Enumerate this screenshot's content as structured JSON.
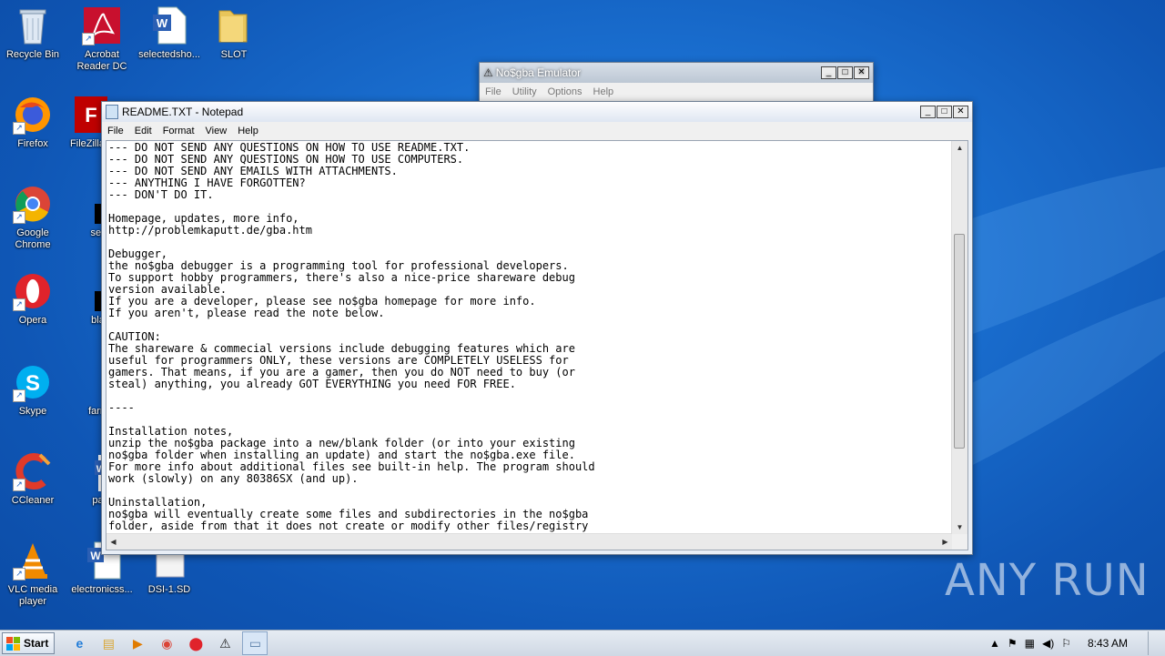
{
  "desktop_icons": [
    {
      "label": "Recycle Bin",
      "icon": "recycle-bin-icon"
    },
    {
      "label": "Acrobat\nReader DC",
      "icon": "acrobat-icon"
    },
    {
      "label": "selectedsho...",
      "icon": "word-doc-icon"
    },
    {
      "label": "SLOT",
      "icon": "folder-icon"
    },
    {
      "label": "Firefox",
      "icon": "firefox-icon"
    },
    {
      "label": "FileZilla",
      "icon": "filezilla-icon"
    },
    {
      "label": "Google\nChrome",
      "icon": "chrome-icon"
    },
    {
      "label": "second",
      "icon": "black-file-icon"
    },
    {
      "label": "Opera",
      "icon": "opera-icon"
    },
    {
      "label": "blackm",
      "icon": "black-file-icon"
    },
    {
      "label": "Skype",
      "icon": "skype-icon"
    },
    {
      "label": "farmore",
      "icon": "generic-file-icon"
    },
    {
      "label": "CCleaner",
      "icon": "ccleaner-icon"
    },
    {
      "label": "papers",
      "icon": "word-doc-icon"
    },
    {
      "label": "VLC media\nplayer",
      "icon": "vlc-icon"
    },
    {
      "label": "electronicss...",
      "icon": "word-doc-icon"
    },
    {
      "label": "DSI-1.SD",
      "icon": "blank-file-icon"
    }
  ],
  "nogba": {
    "title": "No$gba Emulator",
    "menu": [
      "File",
      "Utility",
      "Options",
      "Help"
    ]
  },
  "notepad": {
    "title": "README.TXT - Notepad",
    "menu": [
      "File",
      "Edit",
      "Format",
      "View",
      "Help"
    ],
    "content": "--- DO NOT SEND ANY QUESTIONS ON HOW TO USE README.TXT.\n--- DO NOT SEND ANY QUESTIONS ON HOW TO USE COMPUTERS.\n--- DO NOT SEND ANY EMAILS WITH ATTACHMENTS.\n--- ANYTHING I HAVE FORGOTTEN?\n--- DON'T DO IT.\n\nHomepage, updates, more info,\nhttp://problemkaputt.de/gba.htm\n\nDebugger,\nthe no$gba debugger is a programming tool for professional developers.\nTo support hobby programmers, there's also a nice-price shareware debug\nversion available.\nIf you are a developer, please see no$gba homepage for more info.\nIf you aren't, please read the note below.\n\nCAUTION:\nThe shareware & commecial versions include debugging features which are\nuseful for programmers ONLY, these versions are COMPLETELY USELESS for\ngamers. That means, if you are a gamer, then you do NOT need to buy (or\nsteal) anything, you already GOT EVERYTHING you need FOR FREE.\n\n----\n\nInstallation notes,\nunzip the no$gba package into a new/blank folder (or into your existing\nno$gba folder when installing an update) and start the no$gba.exe file.\nFor more info about additional files see built-in help. The program should\nwork (slowly) on any 80386SX (and up).\n\nUninstallation,\nno$gba will eventually create some files and subdirectories in the no$gba\nfolder, aside from that it does not create or modify other files/registry"
  },
  "taskbar": {
    "start_label": "Start",
    "clock": "8:43 AM"
  },
  "watermark": "ANY RUN"
}
